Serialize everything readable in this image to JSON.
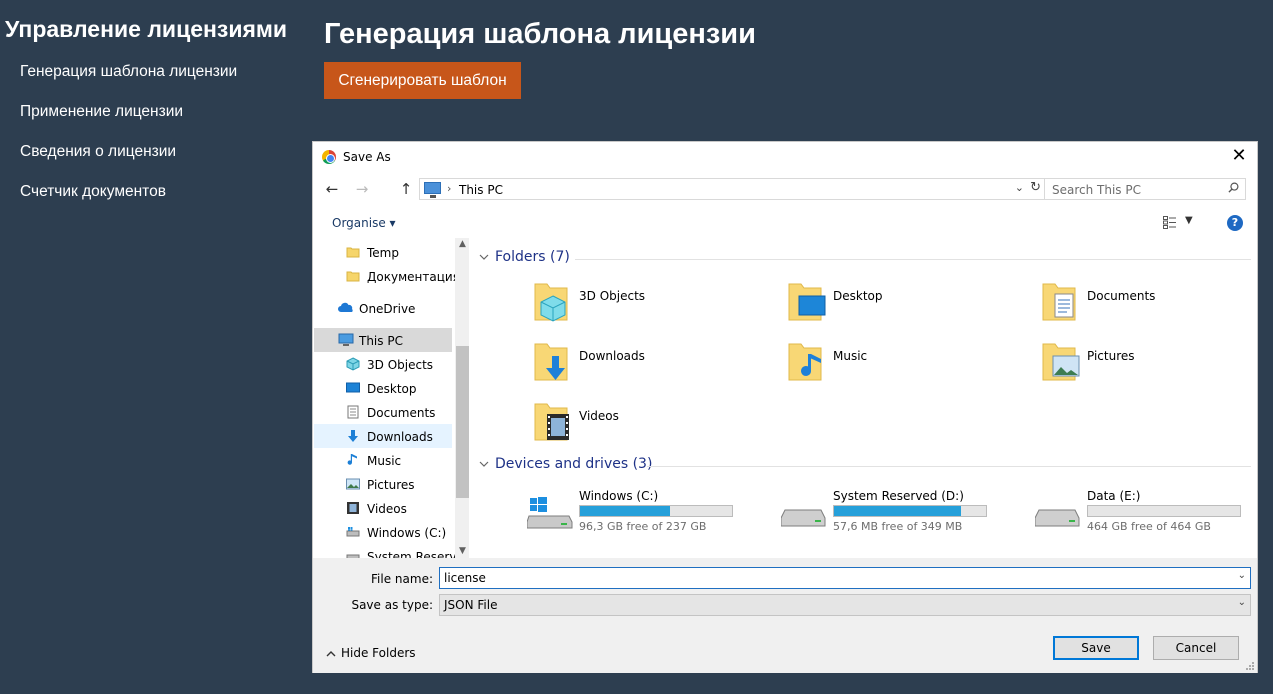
{
  "app": {
    "title": "Управление лицензиями",
    "nav": [
      "Генерация шаблона лицензии",
      "Применение лицензии",
      "Сведения о лицензии",
      "Счетчик документов"
    ],
    "page_title": "Генерация шаблона лицензии",
    "generate_button": "Сгенерировать шаблон",
    "accent": "#c7561a",
    "background": "#2d3e50"
  },
  "dialog": {
    "title": "Save As",
    "close": "✕",
    "nav_back": "←",
    "nav_forward": "→",
    "nav_up": "↑",
    "address": "This PC",
    "address_sep": "›",
    "search_placeholder": "Search This PC",
    "organise": "Organise ▾",
    "help": "?",
    "tree": [
      {
        "label": "Temp",
        "icon": "folder-icon"
      },
      {
        "label": "Документация",
        "icon": "folder-icon"
      },
      {
        "label": "OneDrive",
        "icon": "onedrive-icon"
      },
      {
        "label": "This PC",
        "icon": "pc-icon",
        "selected": true
      },
      {
        "label": "3D Objects",
        "icon": "cube-icon"
      },
      {
        "label": "Desktop",
        "icon": "desktop-icon"
      },
      {
        "label": "Documents",
        "icon": "document-icon"
      },
      {
        "label": "Downloads",
        "icon": "download-icon",
        "hover": true
      },
      {
        "label": "Music",
        "icon": "music-icon"
      },
      {
        "label": "Pictures",
        "icon": "pictures-icon"
      },
      {
        "label": "Videos",
        "icon": "video-icon"
      },
      {
        "label": "Windows (C:)",
        "icon": "drive-icon"
      },
      {
        "label": "System Reserved",
        "icon": "drive-icon"
      }
    ],
    "folders_header": "Folders (7)",
    "folders": [
      {
        "name": "3D Objects",
        "icon": "cube-icon"
      },
      {
        "name": "Desktop",
        "icon": "desktop-icon"
      },
      {
        "name": "Documents",
        "icon": "document-icon"
      },
      {
        "name": "Downloads",
        "icon": "download-icon"
      },
      {
        "name": "Music",
        "icon": "music-icon"
      },
      {
        "name": "Pictures",
        "icon": "pictures-icon"
      },
      {
        "name": "Videos",
        "icon": "video-icon"
      }
    ],
    "drives_header": "Devices and drives (3)",
    "drives": [
      {
        "name": "Windows (C:)",
        "free": "96,3 GB free of 237 GB",
        "used_fraction": 0.59,
        "icon": "windows-drive-icon"
      },
      {
        "name": "System Reserved (D:)",
        "free": "57,6 MB free of 349 MB",
        "used_fraction": 0.835,
        "icon": "hdd-icon"
      },
      {
        "name": "Data (E:)",
        "free": "464 GB free of 464 GB",
        "used_fraction": 0.0,
        "icon": "hdd-icon"
      }
    ],
    "file_name_label": "File name:",
    "file_name_value": "license",
    "save_type_label": "Save as type:",
    "save_type_value": "JSON File",
    "hide_folders": "Hide Folders",
    "save_button": "Save",
    "cancel_button": "Cancel"
  }
}
